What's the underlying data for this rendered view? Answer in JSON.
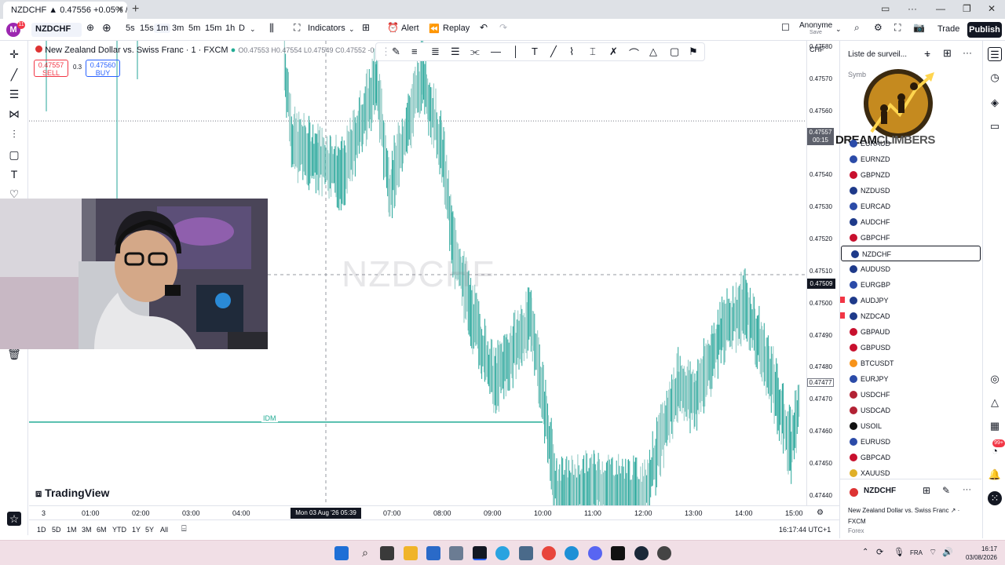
{
  "browser": {
    "tab_title": "NZDCHF ▲ 0.47556 +0.05% / Ano",
    "new_tab": "+"
  },
  "toolbar": {
    "logo_letter": "M",
    "logo_badge": "11",
    "symbol": "NZDCHF",
    "intervals": [
      "5s",
      "15s",
      "1m",
      "3m",
      "5m",
      "15m",
      "1h",
      "D"
    ],
    "active_interval": "1m",
    "indicators_label": "Indicators",
    "alert_label": "Alert",
    "replay_label": "Replay",
    "user_name": "Anonyme",
    "user_status": "Save",
    "trade_label": "Trade",
    "publish_label": "Publish"
  },
  "chart": {
    "legend_title": "New Zealand Dollar vs. Swiss Franc · 1 · FXCM",
    "ohlc": "O0.47553 H0.47554 L0.47549 C0.47552 -0",
    "sell_price": "0.47557",
    "sell_label": "SELL",
    "spread": "0.3",
    "buy_price": "0.47560",
    "buy_label": "BUY",
    "watermark": "NZDCHF",
    "brand": "TradingView",
    "idm_label": "IDM",
    "currency": "CHF",
    "current_price": "0.47557",
    "current_countdown": "00:15",
    "crosshair_price": "0.47509",
    "alt_price": "0.47477",
    "crosshair_time": "Mon 03 Aug '26   05:39"
  },
  "chart_data": {
    "type": "candlestick",
    "title": "New Zealand Dollar vs. Swiss Franc · 1 · FXCM",
    "ylabel": "CHF",
    "ylim": [
      0.47437,
      0.47582
    ],
    "y_ticks": [
      "0.47580",
      "0.47570",
      "0.47560",
      "0.47550",
      "0.47540",
      "0.47530",
      "0.47520",
      "0.47510",
      "0.47500",
      "0.47490",
      "0.47480",
      "0.47470",
      "0.47460",
      "0.47450",
      "0.47440"
    ],
    "x_ticks": [
      "3",
      "01:00",
      "02:00",
      "03:00",
      "04:00",
      "05:00",
      "07:00",
      "08:00",
      "09:00",
      "10:00",
      "11:00",
      "12:00",
      "13:00",
      "14:00",
      "15:00"
    ],
    "idm_level": 0.47463,
    "last_price": 0.47557,
    "price_path": [
      [
        "04:50",
        0.47575
      ],
      [
        "05:00",
        0.4755
      ],
      [
        "05:30",
        0.47545
      ],
      [
        "06:00",
        0.4754
      ],
      [
        "06:40",
        0.4757
      ],
      [
        "06:55",
        0.47535
      ],
      [
        "07:35",
        0.47572
      ],
      [
        "08:00",
        0.47545
      ],
      [
        "08:10",
        0.4752
      ],
      [
        "08:30",
        0.475
      ],
      [
        "09:00",
        0.47475
      ],
      [
        "09:45",
        0.47495
      ],
      [
        "10:05",
        0.4746
      ],
      [
        "10:15",
        0.4744
      ],
      [
        "11:00",
        0.47443
      ],
      [
        "12:00",
        0.4744
      ],
      [
        "12:40",
        0.47475
      ],
      [
        "13:00",
        0.4747
      ],
      [
        "13:30",
        0.4749
      ],
      [
        "14:00",
        0.475
      ],
      [
        "14:30",
        0.47478
      ],
      [
        "14:55",
        0.47455
      ],
      [
        "15:05",
        0.4747
      ]
    ]
  },
  "time_axis": {
    "ticks": [
      "3",
      "01:00",
      "02:00",
      "03:00",
      "04:00",
      "07:00",
      "08:00",
      "09:00",
      "10:00",
      "11:00",
      "12:00",
      "13:00",
      "14:00",
      "15:00"
    ]
  },
  "range": {
    "buttons": [
      "1D",
      "5D",
      "1M",
      "3M",
      "6M",
      "YTD",
      "1Y",
      "5Y",
      "All"
    ],
    "clock": "16:17:44 UTC+1"
  },
  "watchlist": {
    "title": "Liste de surveil...",
    "symbol_header": "Symb",
    "logo_text_a": "DREAM",
    "logo_text_b": "CLIMBERS",
    "items": [
      "EURAUD",
      "EURNZD",
      "GBPNZD",
      "NZDUSD",
      "EURCAD",
      "AUDCHF",
      "GBPCHF",
      "NZDCHF",
      "AUDUSD",
      "EURGBP",
      "AUDJPY",
      "NZDCAD",
      "GBPAUD",
      "GBPUSD",
      "BTCUSDT",
      "EURJPY",
      "USDCHF",
      "USDCAD",
      "USOIL",
      "EURUSD",
      "GBPCAD",
      "XAUUSD"
    ],
    "selected": "NZDCHF",
    "detail_symbol": "NZDCHF",
    "detail_name": "New Zealand Dollar vs. Swiss Franc",
    "detail_exchange": "FXCM",
    "detail_type": "Forex"
  },
  "right_strip": {
    "notif_badge": "99+"
  },
  "taskbar": {
    "lang": "FRA",
    "time": "16:17",
    "date": "03/08/2026"
  }
}
